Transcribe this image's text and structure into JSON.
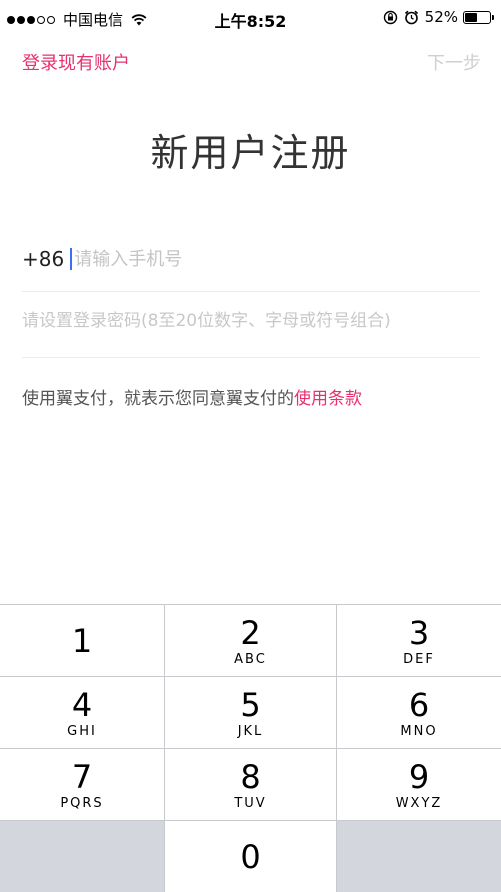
{
  "status_bar": {
    "carrier": "中国电信",
    "time": "上午8:52",
    "battery": "52%",
    "battery_level": 0.52,
    "icons": [
      "signal-icon",
      "wifi-icon",
      "rotation-lock-icon",
      "alarm-icon",
      "battery-icon"
    ]
  },
  "nav": {
    "login_label": "登录现有账户",
    "next_label": "下一步"
  },
  "title": "新用户注册",
  "phone": {
    "country_code": "+86",
    "placeholder": "请输入手机号",
    "value": ""
  },
  "password": {
    "placeholder": "请设置登录密码(8至20位数字、字母或符号组合)",
    "value": ""
  },
  "terms": {
    "text": "使用翼支付，就表示您同意翼支付的",
    "link": "使用条款"
  },
  "colors": {
    "accent": "#e8306f",
    "disabled": "#cfcfcf",
    "keypad_blank": "#d3d6dc",
    "caret": "#3b6ff5"
  },
  "keypad": {
    "k1": {
      "num": "1",
      "letters": ""
    },
    "k2": {
      "num": "2",
      "letters": "ABC"
    },
    "k3": {
      "num": "3",
      "letters": "DEF"
    },
    "k4": {
      "num": "4",
      "letters": "GHI"
    },
    "k5": {
      "num": "5",
      "letters": "JKL"
    },
    "k6": {
      "num": "6",
      "letters": "MNO"
    },
    "k7": {
      "num": "7",
      "letters": "PQRS"
    },
    "k8": {
      "num": "8",
      "letters": "TUV"
    },
    "k9": {
      "num": "9",
      "letters": "WXYZ"
    },
    "k0": {
      "num": "0",
      "letters": ""
    }
  }
}
